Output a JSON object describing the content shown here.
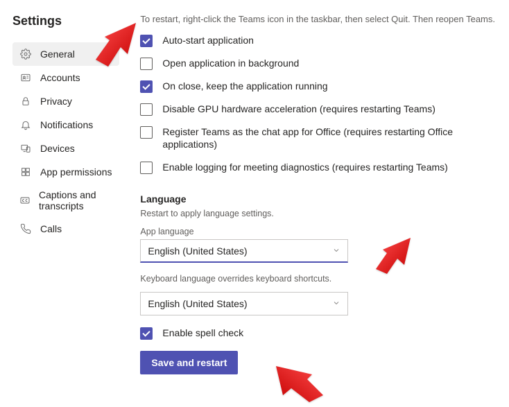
{
  "title": "Settings",
  "sidebar": {
    "items": [
      {
        "label": "General"
      },
      {
        "label": "Accounts"
      },
      {
        "label": "Privacy"
      },
      {
        "label": "Notifications"
      },
      {
        "label": "Devices"
      },
      {
        "label": "App permissions"
      },
      {
        "label": "Captions and transcripts"
      },
      {
        "label": "Calls"
      }
    ]
  },
  "truncated_hint": "To restart, right-click the Teams icon in the taskbar, then select Quit. Then reopen Teams.",
  "options": [
    {
      "label": "Auto-start application",
      "checked": true
    },
    {
      "label": "Open application in background",
      "checked": false
    },
    {
      "label": "On close, keep the application running",
      "checked": true
    },
    {
      "label": "Disable GPU hardware acceleration (requires restarting Teams)",
      "checked": false
    },
    {
      "label": "Register Teams as the chat app for Office (requires restarting Office applications)",
      "checked": false
    },
    {
      "label": "Enable logging for meeting diagnostics (requires restarting Teams)",
      "checked": false
    }
  ],
  "language": {
    "heading": "Language",
    "restart_hint": "Restart to apply language settings.",
    "app_label": "App language",
    "app_value": "English (United States)",
    "kb_hint": "Keyboard language overrides keyboard shortcuts.",
    "kb_value": "English (United States)",
    "spellcheck_label": "Enable spell check",
    "button": "Save and restart"
  }
}
